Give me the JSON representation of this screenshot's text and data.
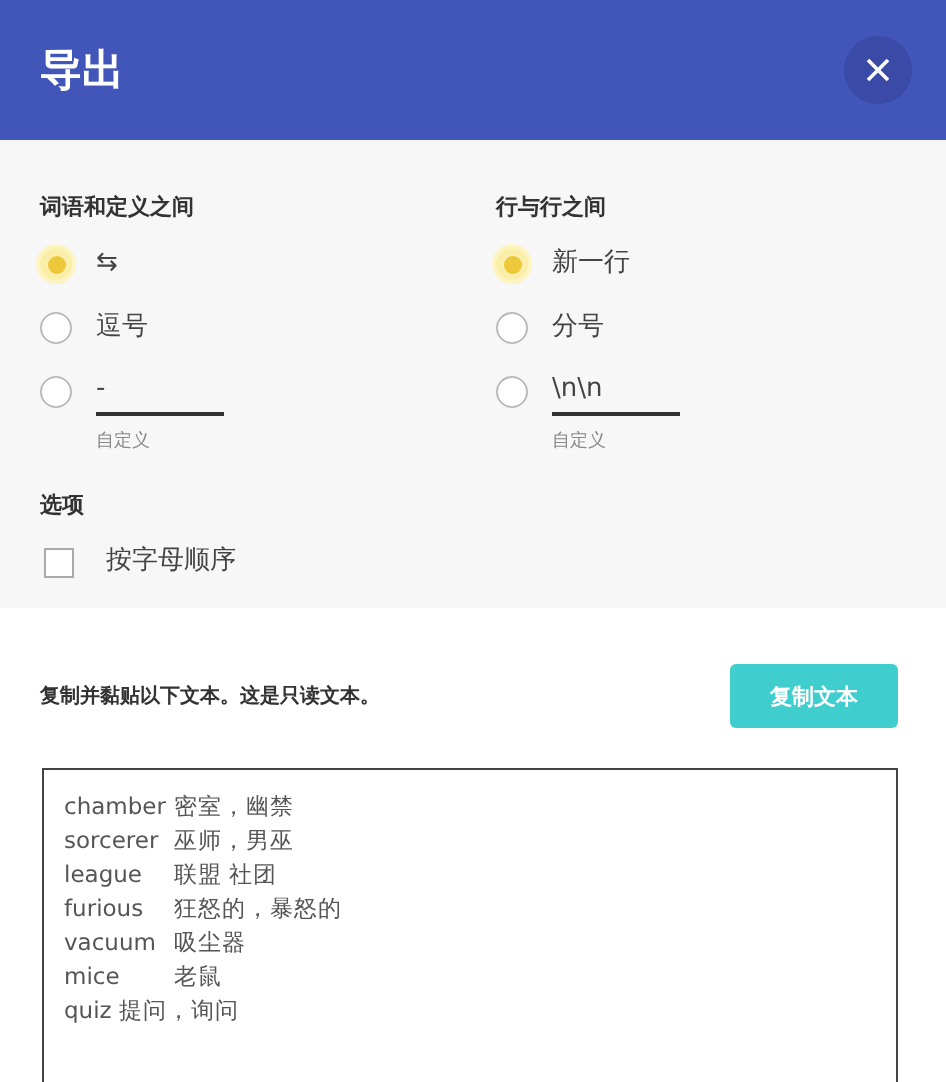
{
  "dialog": {
    "title": "导出"
  },
  "term_separator": {
    "heading": "词语和定义之间",
    "options": [
      {
        "kind": "option",
        "label": "⇆",
        "selected": true
      },
      {
        "kind": "option",
        "label": "逗号",
        "selected": false
      },
      {
        "kind": "custom",
        "value": "-",
        "hint": "自定义",
        "selected": false
      }
    ]
  },
  "row_separator": {
    "heading": "行与行之间",
    "options": [
      {
        "kind": "option",
        "label": "新一行",
        "selected": true
      },
      {
        "kind": "option",
        "label": "分号",
        "selected": false
      },
      {
        "kind": "custom",
        "value": "\\n\\n",
        "hint": "自定义",
        "selected": false
      }
    ]
  },
  "options": {
    "heading": "选项",
    "items": [
      {
        "label": "按字母顺序",
        "checked": false
      }
    ]
  },
  "export": {
    "instruction": "复制并黏贴以下文本。这是只读文本。",
    "copy_button": "复制文本",
    "lines": [
      "chamber\t密室，幽禁",
      "sorcerer\t巫师，男巫",
      "league\t联盟 社团",
      "furious\t狂怒的，暴怒的",
      "vacuum\t吸尘器",
      "mice\t老鼠",
      "quiz 提问，询问"
    ]
  }
}
